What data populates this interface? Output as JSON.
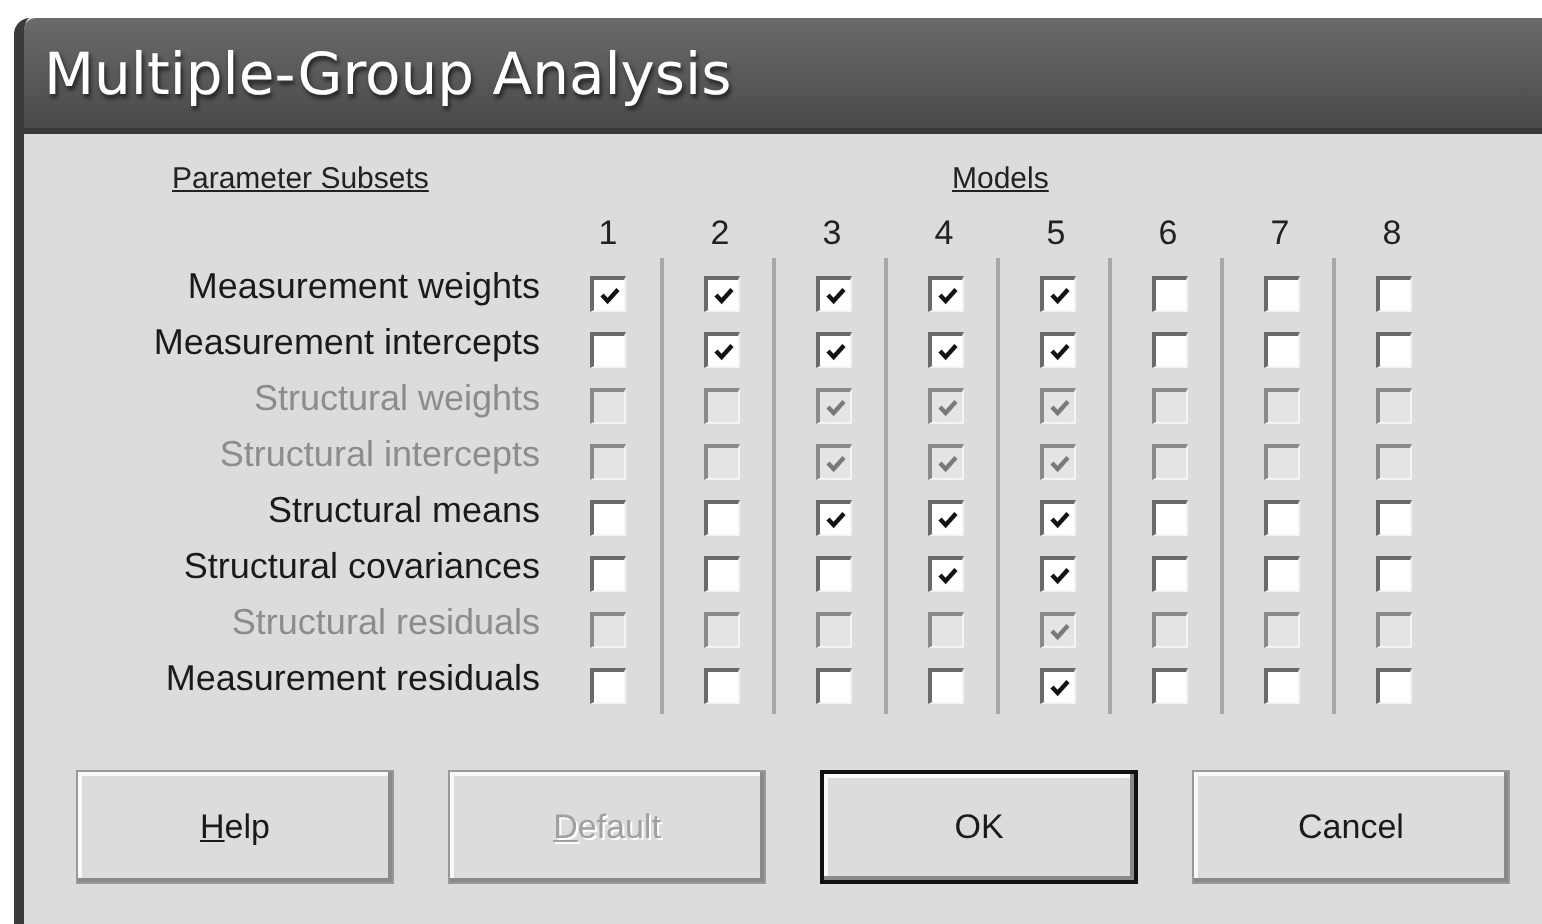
{
  "window": {
    "title": "Multiple-Group Analysis"
  },
  "headings": {
    "subsets": "Parameter Subsets",
    "models": "Models"
  },
  "models": [
    "1",
    "2",
    "3",
    "4",
    "5",
    "6",
    "7",
    "8"
  ],
  "rows": [
    {
      "label": "Measurement weights",
      "disabled": false,
      "checked": [
        true,
        true,
        true,
        true,
        true,
        false,
        false,
        false
      ]
    },
    {
      "label": "Measurement intercepts",
      "disabled": false,
      "checked": [
        false,
        true,
        true,
        true,
        true,
        false,
        false,
        false
      ]
    },
    {
      "label": "Structural weights",
      "disabled": true,
      "checked": [
        false,
        false,
        true,
        true,
        true,
        false,
        false,
        false
      ]
    },
    {
      "label": "Structural intercepts",
      "disabled": true,
      "checked": [
        false,
        false,
        true,
        true,
        true,
        false,
        false,
        false
      ]
    },
    {
      "label": "Structural means",
      "disabled": false,
      "checked": [
        false,
        false,
        true,
        true,
        true,
        false,
        false,
        false
      ]
    },
    {
      "label": "Structural covariances",
      "disabled": false,
      "checked": [
        false,
        false,
        false,
        true,
        true,
        false,
        false,
        false
      ]
    },
    {
      "label": "Structural residuals",
      "disabled": true,
      "checked": [
        false,
        false,
        false,
        false,
        true,
        false,
        false,
        false
      ]
    },
    {
      "label": "Measurement residuals",
      "disabled": false,
      "checked": [
        false,
        false,
        false,
        false,
        true,
        false,
        false,
        false
      ]
    }
  ],
  "buttons": [
    {
      "label": "Help",
      "disabled": false,
      "default": false,
      "underline_first": true
    },
    {
      "label": "Default",
      "disabled": true,
      "default": false,
      "underline_first": true
    },
    {
      "label": "OK",
      "disabled": false,
      "default": true,
      "underline_first": false
    },
    {
      "label": "Cancel",
      "disabled": false,
      "default": false,
      "underline_first": false
    }
  ]
}
